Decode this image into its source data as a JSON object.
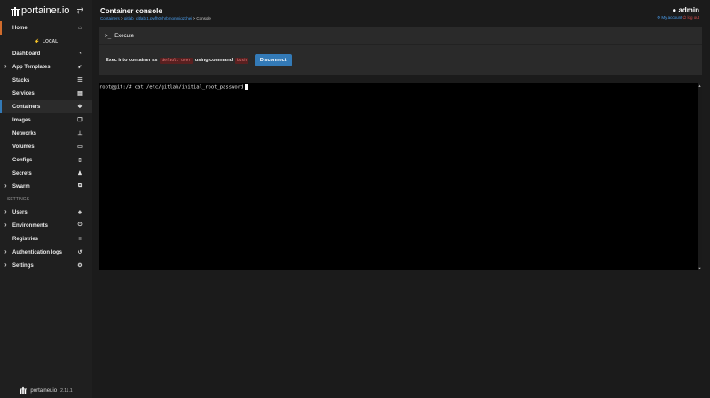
{
  "sidebar": {
    "brand": "portainer.io",
    "toggle_icon": "exchange-icon",
    "home": {
      "label": "Home",
      "icon": "home-icon"
    },
    "environment": {
      "label": "LOCAL",
      "icon": "plug-icon"
    },
    "items": [
      {
        "label": "Dashboard",
        "icon": "dashboard-icon",
        "caret": false
      },
      {
        "label": "App Templates",
        "icon": "rocket-icon",
        "caret": true
      },
      {
        "label": "Stacks",
        "icon": "stacks-icon",
        "caret": false
      },
      {
        "label": "Services",
        "icon": "services-icon",
        "caret": false
      },
      {
        "label": "Containers",
        "icon": "cubes-icon",
        "caret": false,
        "active": true
      },
      {
        "label": "Images",
        "icon": "images-icon",
        "caret": false
      },
      {
        "label": "Networks",
        "icon": "sitemap-icon",
        "caret": false
      },
      {
        "label": "Volumes",
        "icon": "hdd-icon",
        "caret": false
      },
      {
        "label": "Configs",
        "icon": "file-icon",
        "caret": false
      },
      {
        "label": "Secrets",
        "icon": "user-secret-icon",
        "caret": false
      },
      {
        "label": "Swarm",
        "icon": "object-group-icon",
        "caret": true
      }
    ],
    "settings_label": "SETTINGS",
    "settings_items": [
      {
        "label": "Users",
        "icon": "users-icon",
        "caret": true
      },
      {
        "label": "Environments",
        "icon": "plug-icon",
        "caret": true
      },
      {
        "label": "Registries",
        "icon": "database-icon",
        "caret": false
      },
      {
        "label": "Authentication logs",
        "icon": "history-icon",
        "caret": true
      },
      {
        "label": "Settings",
        "icon": "cogs-icon",
        "caret": true
      }
    ],
    "footer_brand": "portainer.io",
    "version": "2.11.1"
  },
  "header": {
    "title": "Container console",
    "breadcrumb": {
      "containers": "Containers",
      "container_name": "gitlab_gitlab.1.pwfh0vhrbmonmjqzchei",
      "current": "Console"
    },
    "user": "admin",
    "my_account": "My account",
    "log_out": "log out"
  },
  "panel": {
    "title": "Execute",
    "exec_prefix": "Exec into container as",
    "user_code": "default user",
    "command_prefix": "using command",
    "command_code": "bash",
    "disconnect_label": "Disconnect"
  },
  "terminal": {
    "prompt": "root@git:/# ",
    "command": "cat /etc/gitlab/initial_root_password"
  },
  "colors": {
    "accent": "#337ab7",
    "home_marker": "#d06b2c",
    "code_bg": "#5a2020",
    "code_fg": "#f08080"
  }
}
